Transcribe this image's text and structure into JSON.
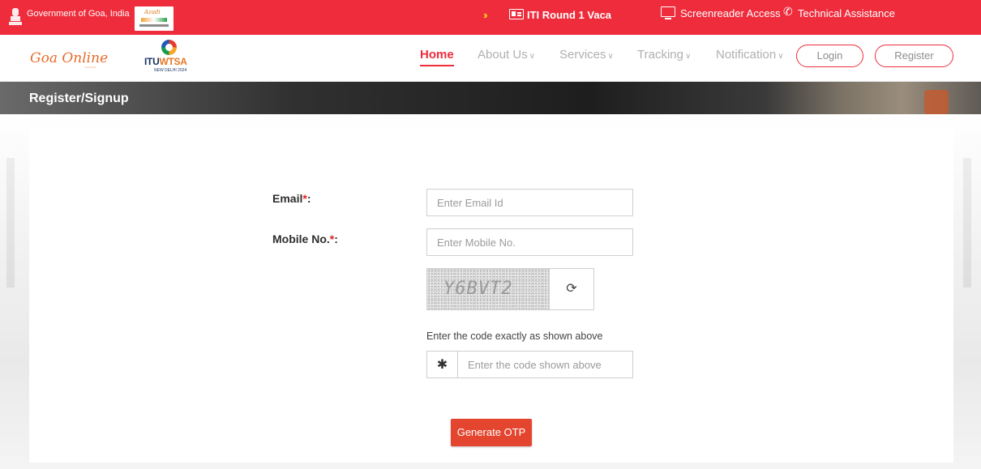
{
  "topbar": {
    "gov_text": "Government of Goa, India",
    "ticker_text": "ITI Round 1 Vaca",
    "screenreader_label": "Screenreader Access",
    "technical_label": "Technical Assistance",
    "bg_color": "#ee2c3c"
  },
  "nav": {
    "logo_text": "Goa Online",
    "itu_logo": {
      "itu": "ITU",
      "wtsa": "WTSA",
      "sub": "NEW DELHI 2024"
    },
    "items": [
      {
        "label": "Home",
        "active": true
      },
      {
        "label": "About Us",
        "dropdown": true
      },
      {
        "label": "Services",
        "dropdown": true
      },
      {
        "label": "Tracking",
        "dropdown": true
      },
      {
        "label": "Notification",
        "dropdown": true
      }
    ],
    "login_label": "Login",
    "register_label": "Register"
  },
  "banner": {
    "title": "Register/Signup"
  },
  "form": {
    "email_label": "Email",
    "email_placeholder": "Enter Email Id",
    "mobile_label": "Mobile No.",
    "mobile_placeholder": "Enter Mobile No.",
    "required_mark": "*",
    "label_suffix": ":",
    "captcha_text": "Y6BVT2",
    "captcha_hint": "Enter the code exactly as shown above",
    "code_placeholder": "Enter the code shown above",
    "submit_label": "Generate OTP"
  },
  "icons": {
    "emblem": "emblem-icon",
    "ticker": "id-card-icon",
    "screenreader": "monitor-icon",
    "technical": "phone-icon",
    "refresh": "refresh-icon",
    "asterisk": "asterisk-icon"
  },
  "colors": {
    "accent": "#ee2c3c",
    "button": "#e4452f"
  }
}
